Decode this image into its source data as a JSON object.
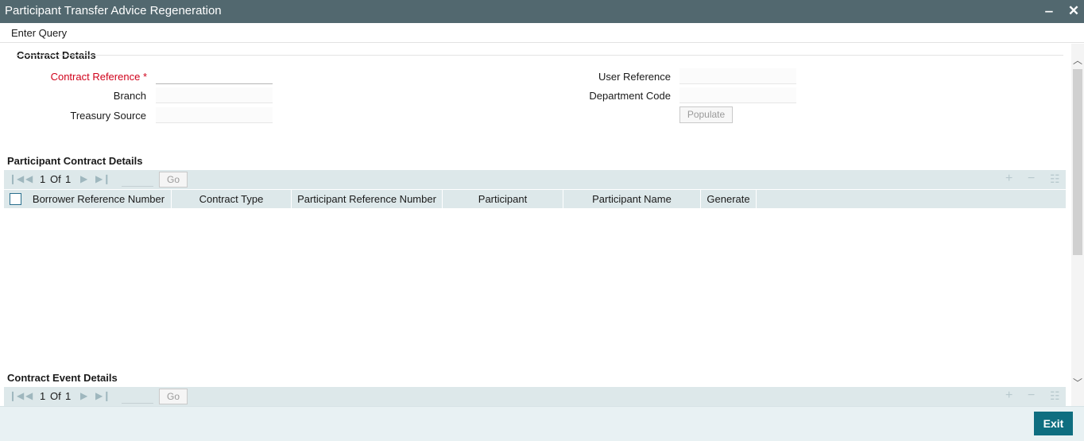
{
  "window": {
    "title": "Participant Transfer Advice Regeneration",
    "minimize_glyph": "‒",
    "close_glyph": "✕"
  },
  "menu": {
    "enter_query": "Enter Query"
  },
  "contract_details": {
    "title": "Contract Details",
    "contract_reference_label": "Contract Reference",
    "required_marker": "*",
    "branch_label": "Branch",
    "treasury_source_label": "Treasury Source",
    "user_reference_label": "User Reference",
    "department_code_label": "Department Code",
    "populate_label": "Populate",
    "contract_reference_value": "",
    "branch_value": "",
    "treasury_source_value": "",
    "user_reference_value": "",
    "department_code_value": ""
  },
  "participant_contract_details": {
    "title": "Participant Contract Details",
    "pager": {
      "current": "1",
      "of_label": "Of",
      "total": "1",
      "go_label": "Go"
    },
    "columns": [
      "Borrower Reference Number",
      "Contract Type",
      "Participant Reference Number",
      "Participant",
      "Participant Name",
      "Generate"
    ],
    "rows": []
  },
  "contract_event_details": {
    "title": "Contract Event Details",
    "pager": {
      "current": "1",
      "of_label": "Of",
      "total": "1",
      "go_label": "Go"
    }
  },
  "icons": {
    "first_page": "first-page-icon",
    "prev_page": "previous-page-icon",
    "next_page": "next-page-icon",
    "last_page": "last-page-icon",
    "add_row": "add-row-icon",
    "delete_row": "delete-row-icon",
    "single_view": "single-view-icon"
  },
  "footer": {
    "exit_label": "Exit"
  },
  "colors": {
    "titlebar": "#52686f",
    "accent": "#0f6e80",
    "required": "#d0021b",
    "grid_header": "#dde8ea"
  }
}
